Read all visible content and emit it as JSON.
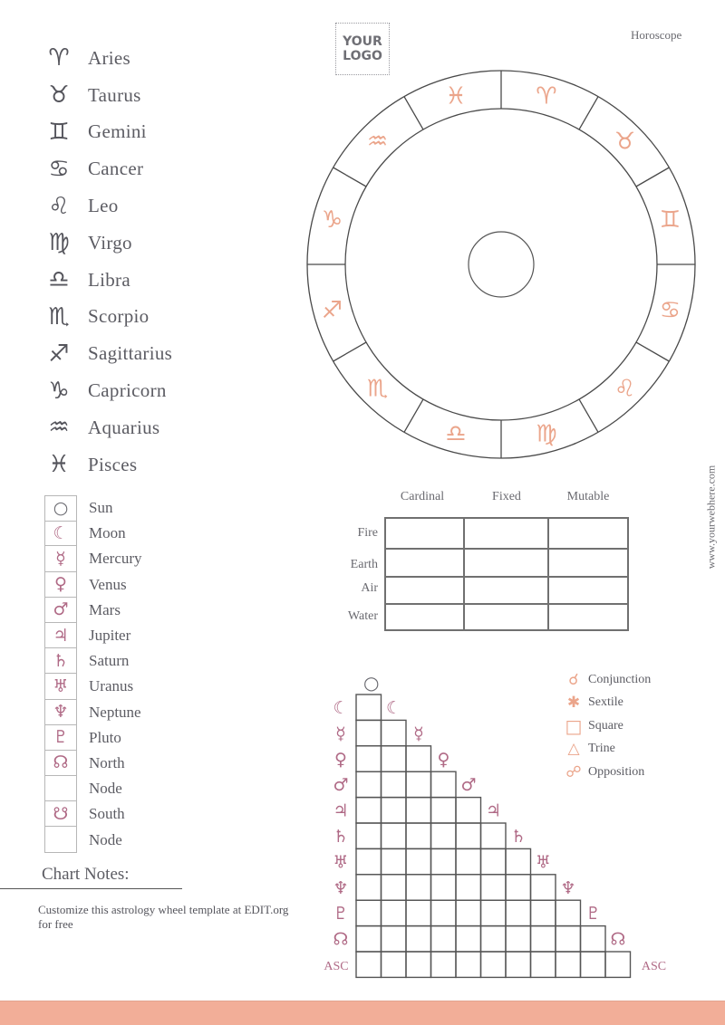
{
  "header": {
    "logo_line1": "YOUR",
    "logo_line2": "LOGO",
    "title": "Horoscope",
    "website": "www.yourwebhere.com"
  },
  "zodiac_signs": [
    {
      "name": "Aries",
      "glyph": "♈︎",
      "icon": "aries-icon"
    },
    {
      "name": "Taurus",
      "glyph": "♉︎",
      "icon": "taurus-icon"
    },
    {
      "name": "Gemini",
      "glyph": "♊︎",
      "icon": "gemini-icon"
    },
    {
      "name": "Cancer",
      "glyph": "♋︎",
      "icon": "cancer-icon"
    },
    {
      "name": "Leo",
      "glyph": "♌︎",
      "icon": "leo-icon"
    },
    {
      "name": "Virgo",
      "glyph": "♍︎",
      "icon": "virgo-icon"
    },
    {
      "name": "Libra",
      "glyph": "♎︎",
      "icon": "libra-icon"
    },
    {
      "name": "Scorpio",
      "glyph": "♏︎",
      "icon": "scorpio-icon"
    },
    {
      "name": "Sagittarius",
      "glyph": "♐︎",
      "icon": "sagittarius-icon"
    },
    {
      "name": "Capricorn",
      "glyph": "♑︎",
      "icon": "capricorn-icon"
    },
    {
      "name": "Aquarius",
      "glyph": "♒︎",
      "icon": "aquarius-icon"
    },
    {
      "name": "Pisces",
      "glyph": "♓︎",
      "icon": "pisces-icon"
    }
  ],
  "planets": [
    {
      "label": "Sun",
      "glyph": "○",
      "icon": "sun-icon"
    },
    {
      "label": "Moon",
      "glyph": "☾",
      "icon": "moon-icon"
    },
    {
      "label": "Mercury",
      "glyph": "☿",
      "icon": "mercury-icon"
    },
    {
      "label": "Venus",
      "glyph": "♀",
      "icon": "venus-icon"
    },
    {
      "label": "Mars",
      "glyph": "♂",
      "icon": "mars-icon"
    },
    {
      "label": "Jupiter",
      "glyph": "♃",
      "icon": "jupiter-icon"
    },
    {
      "label": "Saturn",
      "glyph": "♄",
      "icon": "saturn-icon"
    },
    {
      "label": "Uranus",
      "glyph": "♅",
      "icon": "uranus-icon"
    },
    {
      "label": "Neptune",
      "glyph": "♆",
      "icon": "neptune-icon"
    },
    {
      "label": "Pluto",
      "glyph": "♇",
      "icon": "pluto-icon"
    },
    {
      "label": "North",
      "glyph": "☊",
      "icon": "north-node-icon"
    },
    {
      "label": "Node",
      "glyph": "",
      "icon": ""
    },
    {
      "label": "South",
      "glyph": "☋",
      "icon": "south-node-icon"
    },
    {
      "label": "Node",
      "glyph": "",
      "icon": ""
    }
  ],
  "notes": {
    "title": "Chart Notes:",
    "text": "Customize this astrology wheel template at EDIT.org for free"
  },
  "wheel": {
    "signs_clockwise_from_top": [
      "♈︎",
      "♉︎",
      "♊︎",
      "♋︎",
      "♌︎",
      "♍︎",
      "♎︎",
      "♏︎",
      "♐︎",
      "♑︎",
      "♒︎",
      "♓︎"
    ],
    "sign_names": [
      "Aries",
      "Taurus",
      "Gemini",
      "Cancer",
      "Leo",
      "Virgo",
      "Libra",
      "Scorpio",
      "Sagittarius",
      "Capricorn",
      "Aquarius",
      "Pisces"
    ],
    "sign_color": "#eba58b"
  },
  "elements_table": {
    "columns": [
      "Cardinal",
      "Fixed",
      "Mutable"
    ],
    "rows": [
      "Fire",
      "Earth",
      "Air",
      "Water"
    ]
  },
  "aspect_grid": {
    "top_glyph": "○",
    "row_glyphs": [
      "☾",
      "☿",
      "♀",
      "♂",
      "♃",
      "♄",
      "♅",
      "♆",
      "♇",
      "☊"
    ],
    "row_names": [
      "Moon",
      "Mercury",
      "Venus",
      "Mars",
      "Jupiter",
      "Saturn",
      "Uranus",
      "Neptune",
      "Pluto",
      "North Node"
    ],
    "asc_label": "ASC",
    "glyph_color": "#b06a86"
  },
  "legend": [
    {
      "label": "Conjunction",
      "glyph": "☌",
      "icon": "conjunction-icon"
    },
    {
      "label": "Sextile",
      "glyph": "✱",
      "icon": "sextile-icon"
    },
    {
      "label": "Square",
      "glyph": "□",
      "icon": "square-icon"
    },
    {
      "label": "Trine",
      "glyph": "△",
      "icon": "trine-icon"
    },
    {
      "label": "Opposition",
      "glyph": "☍",
      "icon": "opposition-icon"
    }
  ],
  "colors": {
    "accent": "#f2ae98",
    "zodiac_wheel_glyph": "#eba58b",
    "planet_glyph": "#b06a86",
    "text": "#5c5c63"
  }
}
